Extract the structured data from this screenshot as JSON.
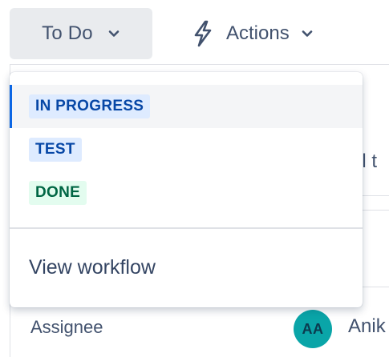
{
  "toolbar": {
    "status_label": "To Do",
    "actions_label": "Actions"
  },
  "dropdown": {
    "items": [
      {
        "label": "IN PROGRESS",
        "color": "#0747a6",
        "background": "#deebff",
        "selected": true
      },
      {
        "label": "TEST",
        "color": "#0747a6",
        "background": "#deebff",
        "selected": false
      },
      {
        "label": "DONE",
        "color": "#006644",
        "background": "#e3fcef",
        "selected": false
      }
    ],
    "view_workflow_label": "View workflow"
  },
  "background": {
    "partial_text": "el t",
    "assignee_label": "Assignee",
    "assignee_initials": "AA",
    "assignee_name": "Anik"
  },
  "icons": {
    "status_chevron": "chevron-down-icon",
    "actions_icon": "lightning-bolt-icon",
    "actions_chevron": "chevron-down-icon"
  },
  "colors": {
    "accent": "#0c66e4",
    "avatar": "#0aa5a8"
  }
}
